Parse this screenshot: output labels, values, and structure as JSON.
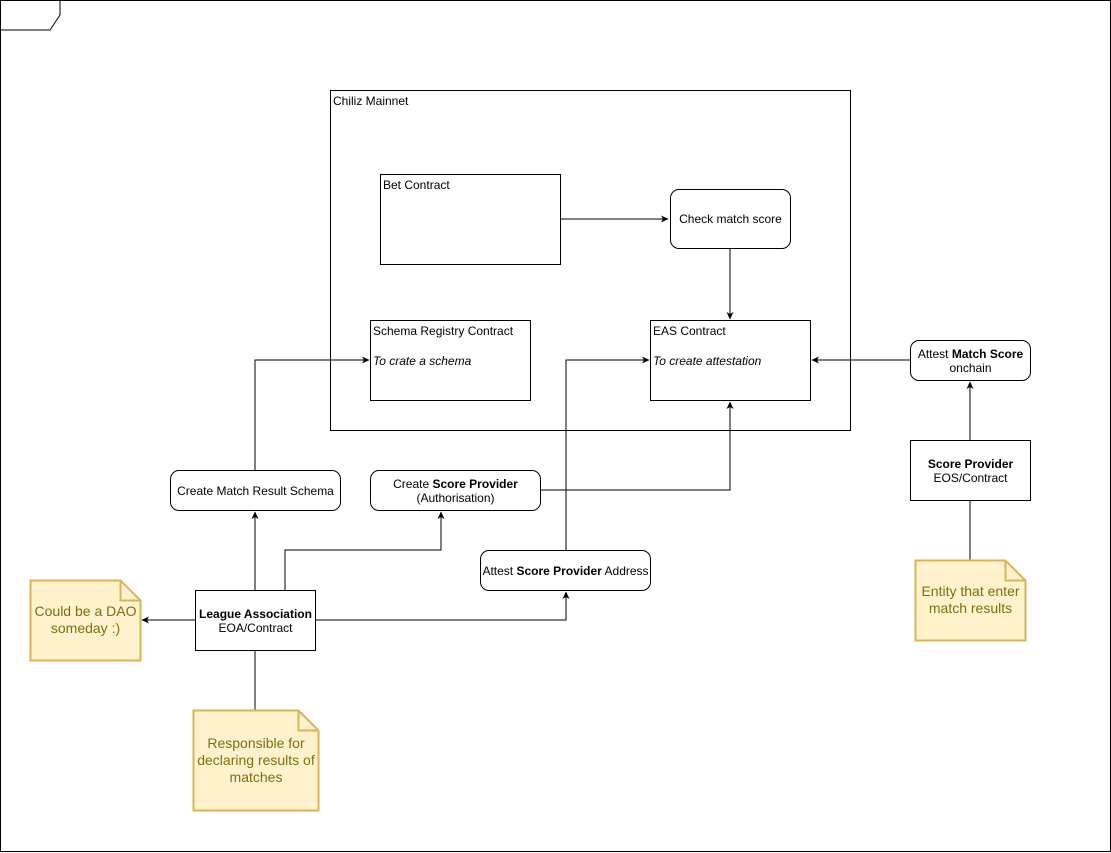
{
  "frame": {
    "label": ""
  },
  "container": {
    "title": "Chiliz Mainnet"
  },
  "nodes": {
    "bet_contract": {
      "title": "Bet Contract"
    },
    "check_match_score": {
      "label": "Check match score"
    },
    "schema_registry": {
      "title": "Schema Registry Contract",
      "subtitle": "To crate a schema"
    },
    "eas_contract": {
      "title": "EAS Contract",
      "subtitle": "To create attestation"
    },
    "attest_match_score": {
      "prefix": "Attest ",
      "bold": "Match Score",
      "line2": "onchain"
    },
    "score_provider": {
      "bold": "Score Provider",
      "line2": "EOS/Contract"
    },
    "create_match_result_schema": {
      "label": "Create Match Result Schema"
    },
    "create_score_provider": {
      "prefix": "Create ",
      "bold": "Score Provider",
      "line2": "(Authorisation)"
    },
    "attest_score_provider_address": {
      "prefix": "Attest ",
      "bold": "Score Provider",
      "suffix": " Address"
    },
    "league_association": {
      "bold": "League Association",
      "line2": "EOA/Contract"
    }
  },
  "notes": {
    "dao": {
      "line1": "Could be a DAO",
      "line2": "someday :)"
    },
    "responsible": {
      "line1": "Responsible for",
      "line2": "declaring results of",
      "line3": "matches"
    },
    "entity": {
      "line1": "Entity that enter",
      "line2": "match results"
    }
  },
  "colors": {
    "note_fill": "#fff2cc",
    "note_stroke": "#d6b656",
    "note_text": "#7f6f0f",
    "line": "#000000"
  }
}
